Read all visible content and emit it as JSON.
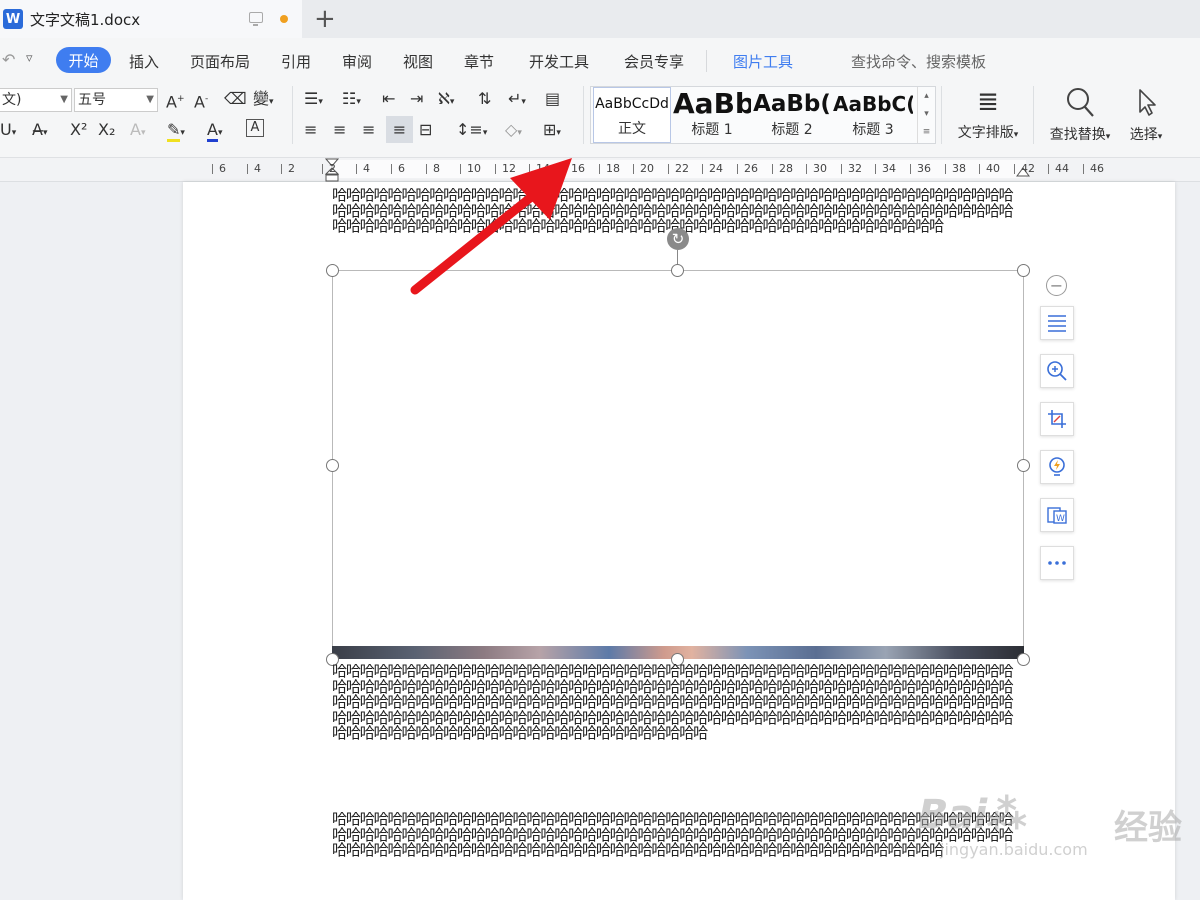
{
  "titlebar": {
    "logo": "W",
    "doc_title": "文字文稿1.docx",
    "new_tab": "+"
  },
  "menu": {
    "undo": "↶",
    "items": [
      "开始",
      "插入",
      "页面布局",
      "引用",
      "审阅",
      "视图",
      "章节",
      "开发工具",
      "会员专享",
      "图片工具"
    ],
    "search_label": "查找命令、搜索模板"
  },
  "ribbon": {
    "font_name": "文)",
    "font_size": "五号",
    "styles": [
      {
        "preview": "AaBbCcDd",
        "label": "正文"
      },
      {
        "preview": "AaBb",
        "label": "标题 1"
      },
      {
        "preview": "AaBb(",
        "label": "标题 2"
      },
      {
        "preview": "AaBbC(",
        "label": "标题 3"
      }
    ],
    "text_layout": "文字排版",
    "find_replace": "查找替换",
    "select": "选择"
  },
  "ruler": {
    "numbers": [
      "6",
      "4",
      "2",
      "2",
      "4",
      "6",
      "8",
      "10",
      "12",
      "14",
      "16",
      "18",
      "20",
      "22",
      "24",
      "26",
      "28",
      "30",
      "32",
      "34",
      "36",
      "38",
      "40",
      "42",
      "44",
      "46"
    ]
  },
  "document": {
    "para1": "哈哈哈哈哈哈哈哈哈哈哈哈哈哈哈哈哈哈哈哈哈哈哈哈哈哈哈哈哈哈哈哈哈哈哈哈哈哈哈哈哈哈哈哈哈哈哈哈哈哈哈哈哈哈哈哈哈哈哈哈哈哈哈哈哈哈哈哈哈哈哈哈哈哈哈哈哈哈哈哈哈哈哈哈哈哈哈哈哈哈哈哈哈哈哈哈哈哈哈哈哈哈哈哈哈哈哈哈哈哈哈哈哈哈哈哈哈哈哈哈哈哈哈哈哈哈哈哈哈哈哈哈哈哈哈哈哈哈哈哈哈哈",
    "para2": "哈哈哈哈哈哈哈哈哈哈哈哈哈哈哈哈哈哈哈哈哈哈哈哈哈哈哈哈哈哈哈哈哈哈哈哈哈哈哈哈哈哈哈哈哈哈哈哈哈哈哈哈哈哈哈哈哈哈哈哈哈哈哈哈哈哈哈哈哈哈哈哈哈哈哈哈哈哈哈哈哈哈哈哈哈哈哈哈哈哈哈哈哈哈哈哈哈哈哈哈哈哈哈哈哈哈哈哈哈哈哈哈哈哈哈哈哈哈哈哈哈哈哈哈哈哈哈哈哈哈哈哈哈哈哈哈哈哈哈哈哈哈哈哈哈哈哈哈哈哈哈哈哈哈哈哈哈哈哈哈哈哈哈哈哈哈哈哈哈哈哈哈哈哈哈哈哈哈哈哈哈哈哈哈哈哈哈哈哈哈哈哈哈哈哈哈哈哈哈哈哈哈哈哈哈哈哈哈哈哈哈哈哈哈哈哈哈哈哈哈哈哈哈",
    "para3": "哈哈哈哈哈哈哈哈哈哈哈哈哈哈哈哈哈哈哈哈哈哈哈哈哈哈哈哈哈哈哈哈哈哈哈哈哈哈哈哈哈哈哈哈哈哈哈哈哈哈哈哈哈哈哈哈哈哈哈哈哈哈哈哈哈哈哈哈哈哈哈哈哈哈哈哈哈哈哈哈哈哈哈哈哈哈哈哈哈哈哈哈哈哈哈哈哈哈哈哈哈哈哈哈哈哈哈哈哈哈哈哈哈哈哈哈哈哈哈哈哈哈哈哈哈哈哈哈哈哈哈哈哈哈哈哈哈哈哈哈哈哈"
  },
  "float_tools": [
    "layout-icon",
    "zoom-in-icon",
    "crop-icon",
    "lightbulb-icon",
    "convert-icon",
    "more-icon"
  ],
  "watermark": {
    "brand": "Bai",
    "product": "经验",
    "url": "jingyan.baidu.com"
  },
  "colors": {
    "accent": "#3f7df0",
    "arrow": "#e8161c"
  }
}
